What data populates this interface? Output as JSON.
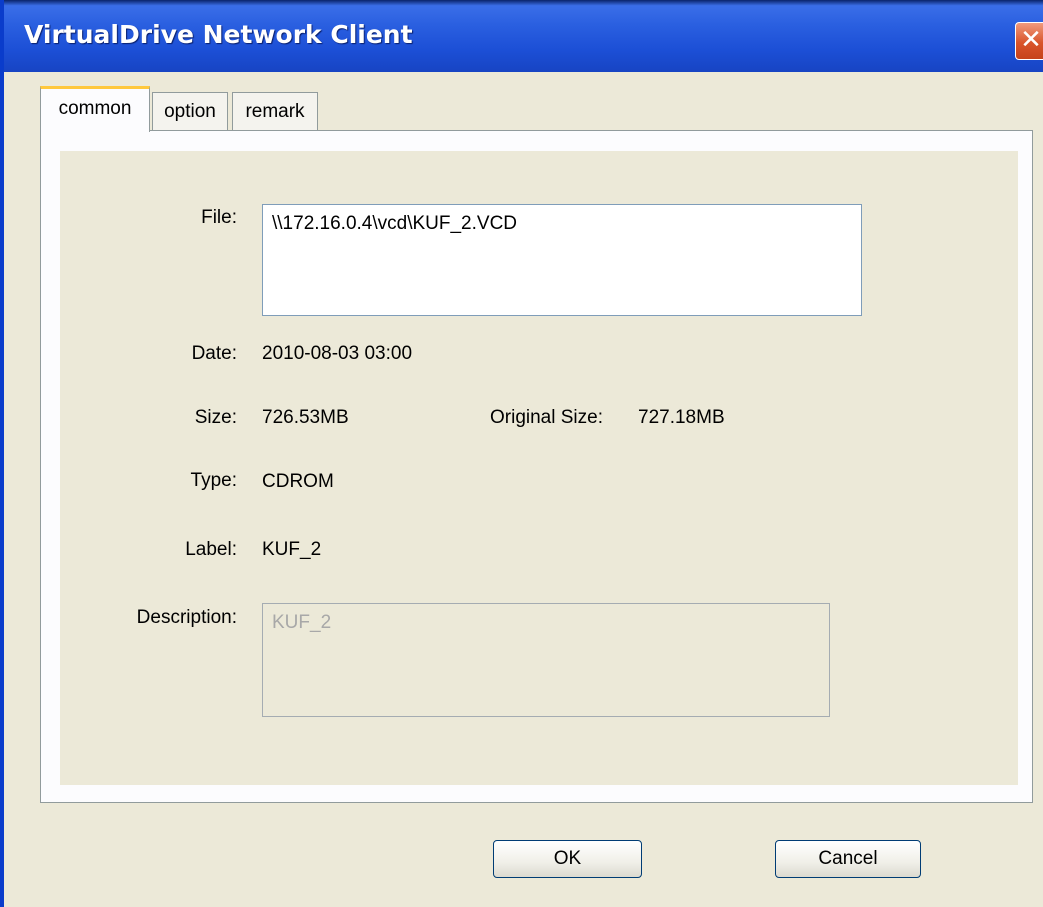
{
  "window": {
    "title": "VirtualDrive Network Client"
  },
  "tabs": [
    {
      "label": "common",
      "active": true
    },
    {
      "label": "option",
      "active": false
    },
    {
      "label": "remark",
      "active": false
    }
  ],
  "fields": {
    "file_label": "File:",
    "file_value": "\\\\172.16.0.4\\vcd\\KUF_2.VCD",
    "date_label": "Date:",
    "date_value": "2010-08-03 03:00",
    "size_label": "Size:",
    "size_value": "726.53MB",
    "original_size_label": "Original Size:",
    "original_size_value": "727.18MB",
    "type_label": "Type:",
    "type_value": "CDROM",
    "label_label": "Label:",
    "label_value": "KUF_2",
    "description_label": "Description:",
    "description_value": "KUF_2"
  },
  "buttons": {
    "ok": "OK",
    "cancel": "Cancel"
  },
  "icons": {
    "close": "close-icon"
  },
  "colors": {
    "titlebar": "#1c4fd6",
    "dialog_bg": "#ece9d8",
    "tab_highlight": "#ffc83c",
    "close_button": "#d9542b",
    "disabled_text": "#a8a8a8"
  }
}
